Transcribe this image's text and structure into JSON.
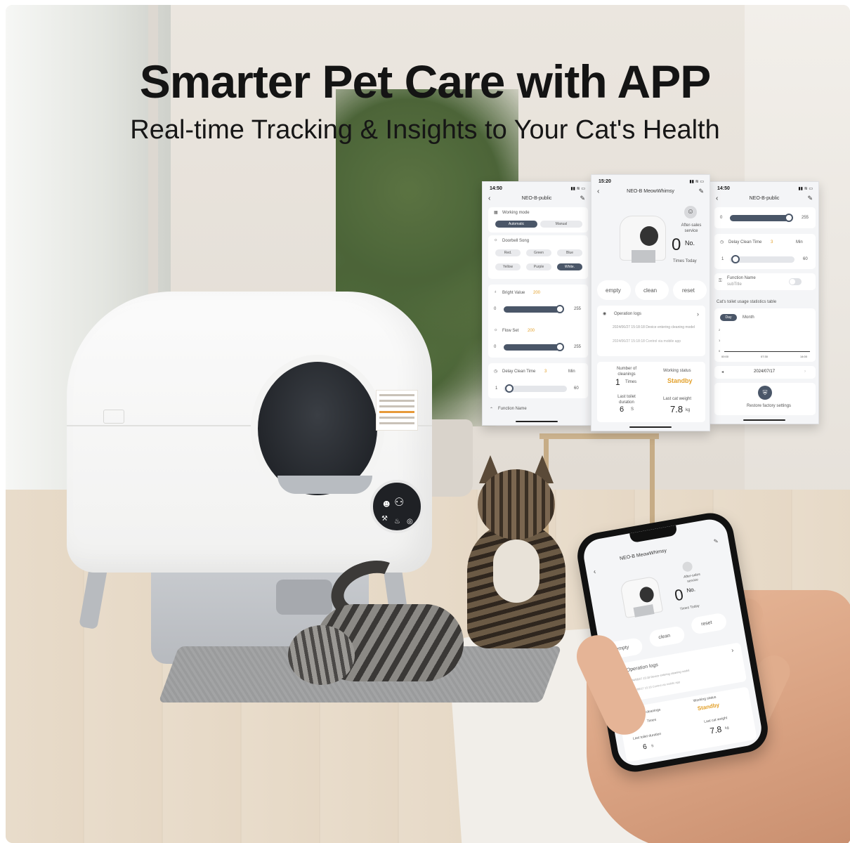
{
  "hero": {
    "title": "Smarter Pet Care with APP",
    "subtitle": "Real-time Tracking & Insights to Your Cat's Health"
  },
  "device_panel": {
    "icons": [
      "☻",
      "⚇",
      "⚒",
      "♨",
      "◎"
    ]
  },
  "screen_left": {
    "time": "14:50",
    "device_name": "NEO-B-public",
    "working_mode_label": "Working mode",
    "mode_automatic": "Automatic",
    "mode_manual": "Manual",
    "doorbell_label": "Doorbell Song",
    "songs": [
      "Red.",
      "Green",
      "Blue",
      "Yellow",
      "Purple",
      "White."
    ],
    "bright_label": "Bright Value",
    "bright_value": "200",
    "bright_min": "0",
    "bright_max": "255",
    "flow_label": "Flow Set",
    "flow_value": "200",
    "flow_min": "0",
    "flow_max": "255",
    "delay_label": "Delay Clean Time",
    "delay_value": "3",
    "delay_unit": "Min",
    "delay_min": "1",
    "delay_max": "60",
    "function_name": "Function Name"
  },
  "screen_mid": {
    "time": "15:20",
    "device_name": "NEO-B MeowWhimsy",
    "after_sales": "After-sales service",
    "count": "0",
    "count_suffix": "No.",
    "times_today": "Times Today",
    "btn_empty": "empty",
    "btn_clean": "clean",
    "btn_reset": "reset",
    "operation_logs": "Operation logs",
    "log1": "2024/06/27 15:18:18 Device entering cleaning model",
    "log2": "2024/06/27 15:18:18 Control via mobile app",
    "num_cleanings_label": "Number of cleanings",
    "num_cleanings": "1",
    "num_cleanings_unit": "Times",
    "working_status_label": "Working status",
    "working_status": "Standby",
    "last_toilet_label": "Last toilet duration",
    "last_toilet": "6",
    "last_toilet_unit": "S",
    "last_weight_label": "Last cat weight",
    "last_weight": "7.8",
    "last_weight_unit": "kg"
  },
  "screen_right": {
    "time": "14:50",
    "device_name": "NEO-B-public",
    "slider_min": "0",
    "slider_max": "255",
    "delay_label": "Delay Clean Time",
    "delay_value": "3",
    "delay_unit": "Min",
    "delay_min": "1",
    "delay_max": "60",
    "function_name": "Function Name",
    "subtitle": "subTitle",
    "stats_title": "Cat's toilet usage statistics table",
    "tab_day": "Day",
    "tab_month": "Month",
    "y_ticks": [
      "2",
      "1",
      "0"
    ],
    "x_ticks": [
      "00:00",
      "07:30",
      "14:00"
    ],
    "date": "2024/07/17",
    "restore": "Restore factory settings"
  },
  "phone": {
    "device_name": "NEO-B MeowWhimsy",
    "after_sales": "After-sales service",
    "count": "0",
    "count_suffix": "No.",
    "times_today": "Times Today",
    "btn_empty": "empty",
    "btn_clean": "clean",
    "btn_reset": "reset",
    "operation_logs": "Operation logs",
    "log1": "2024/06/27 15:18 Device entering cleaning model",
    "log2": "2024/06/27 15:18 Control via mobile app",
    "num_cleanings_label": "Number of cleanings",
    "num_cleanings": "1",
    "num_cleanings_unit": "Times",
    "working_status_label": "Working status",
    "working_status": "Standby",
    "last_toilet_label": "Last toilet duration",
    "last_toilet": "6",
    "last_toilet_unit": "S",
    "last_weight_label": "Last cat weight",
    "last_weight": "7.8",
    "last_weight_unit": "kg"
  },
  "colors": {
    "accent_dark": "#4a5668",
    "standby": "#e3a12c",
    "value_orange": "#e3a12c"
  }
}
